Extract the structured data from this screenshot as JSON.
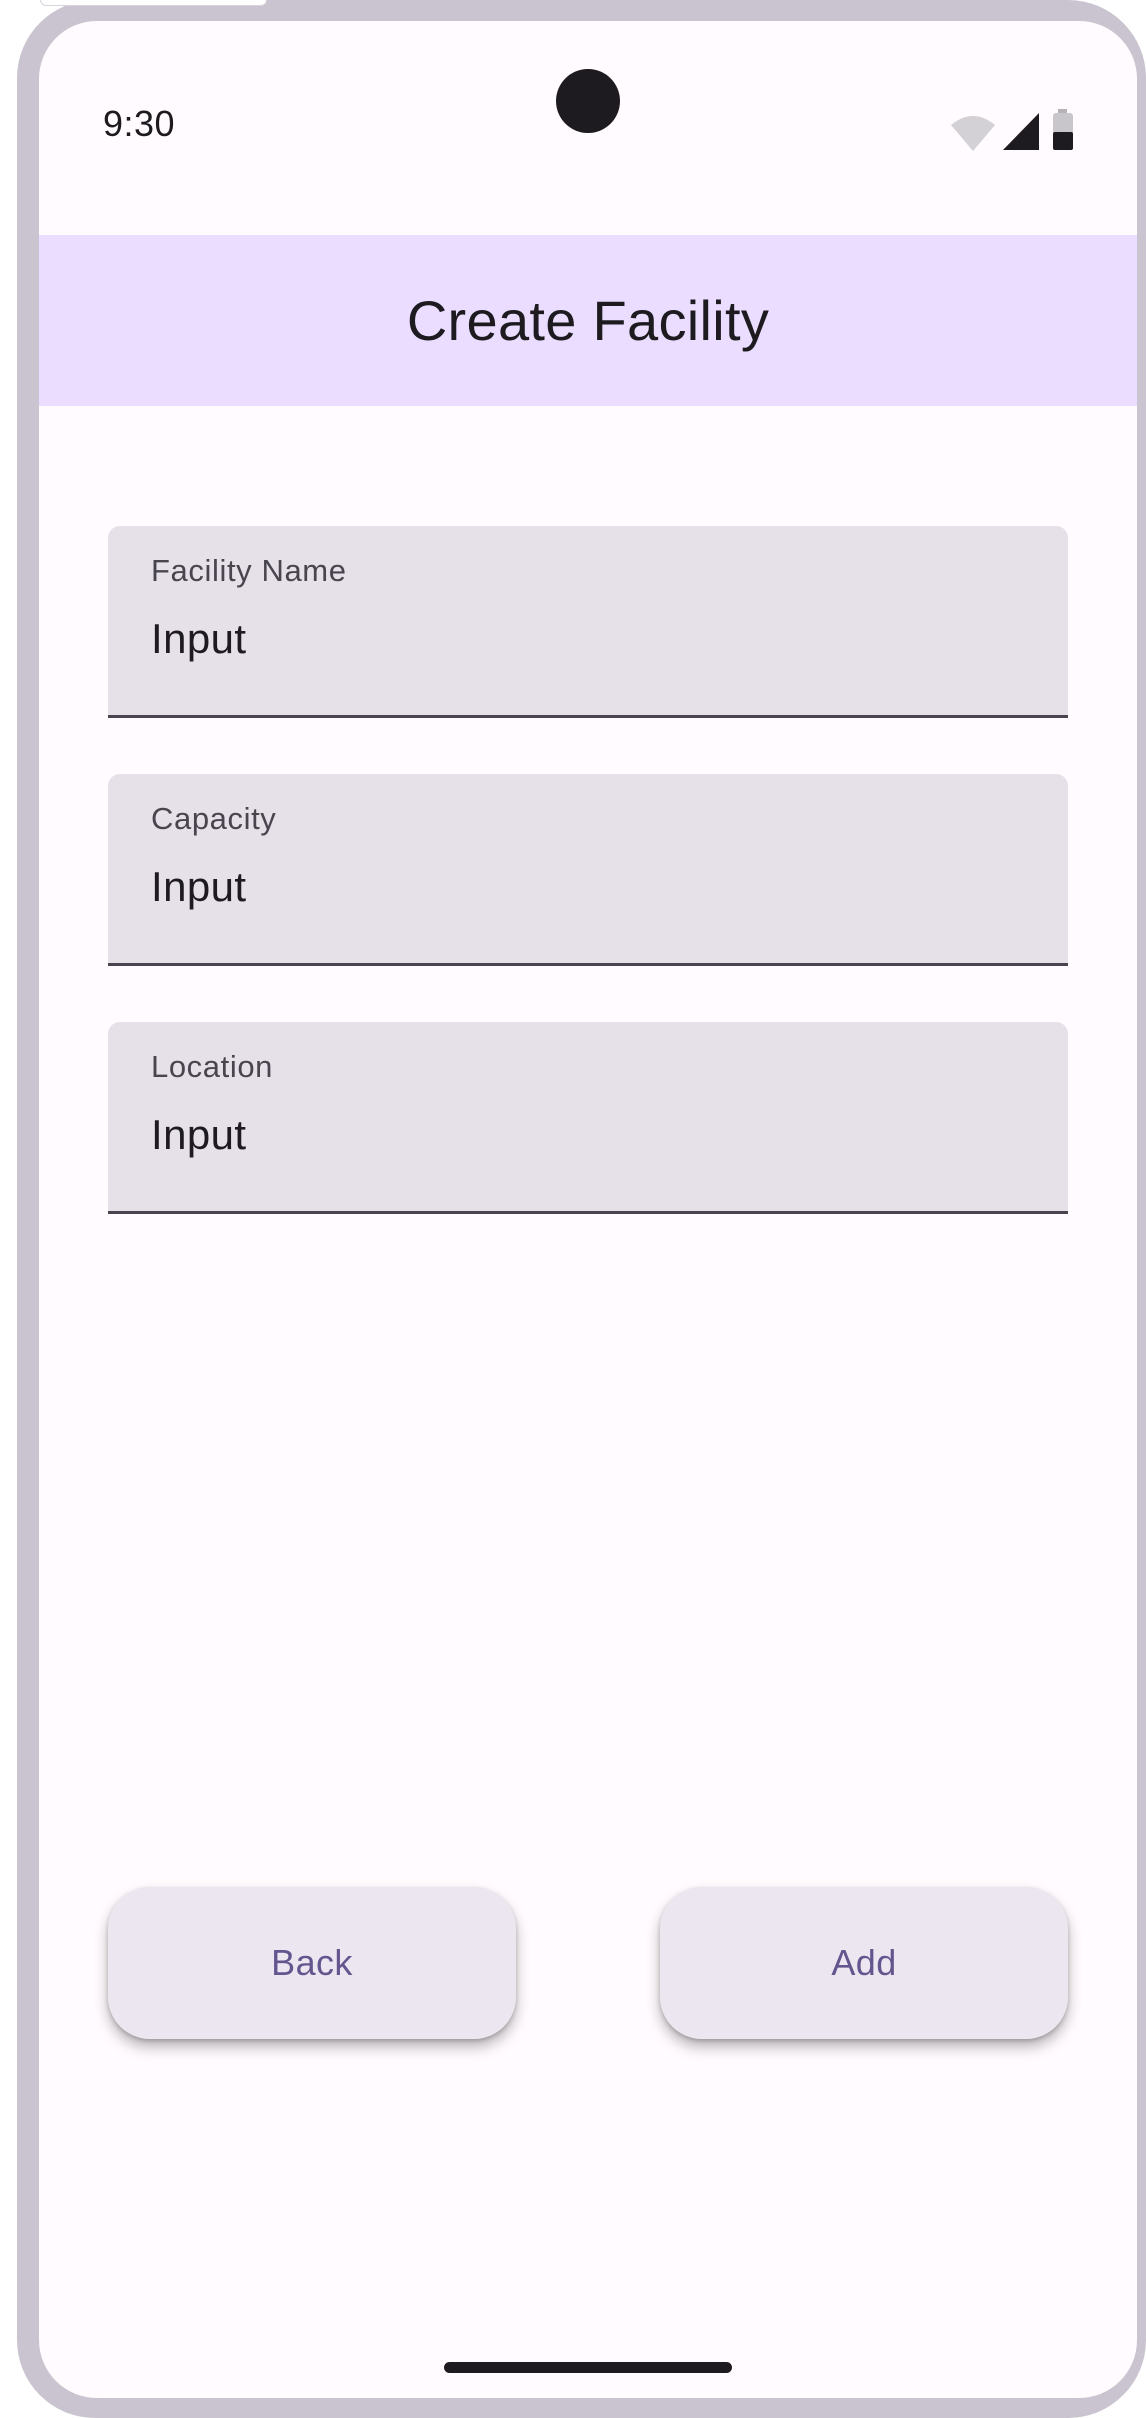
{
  "status_bar": {
    "time": "9:30",
    "icons": [
      "wifi-icon",
      "signal-icon",
      "battery-icon"
    ]
  },
  "app_bar": {
    "title": "Create Facility"
  },
  "form": {
    "fields": [
      {
        "label": "Facility Name",
        "value": "Input"
      },
      {
        "label": "Capacity",
        "value": "Input"
      },
      {
        "label": "Location",
        "value": "Input"
      }
    ]
  },
  "actions": {
    "back_label": "Back",
    "add_label": "Add"
  },
  "colors": {
    "app_bar_bg": "#eaddff",
    "field_bg": "#e6e0e9",
    "button_bg": "#ece6f0",
    "button_text": "#65558f",
    "frame": "#cac4d0"
  }
}
